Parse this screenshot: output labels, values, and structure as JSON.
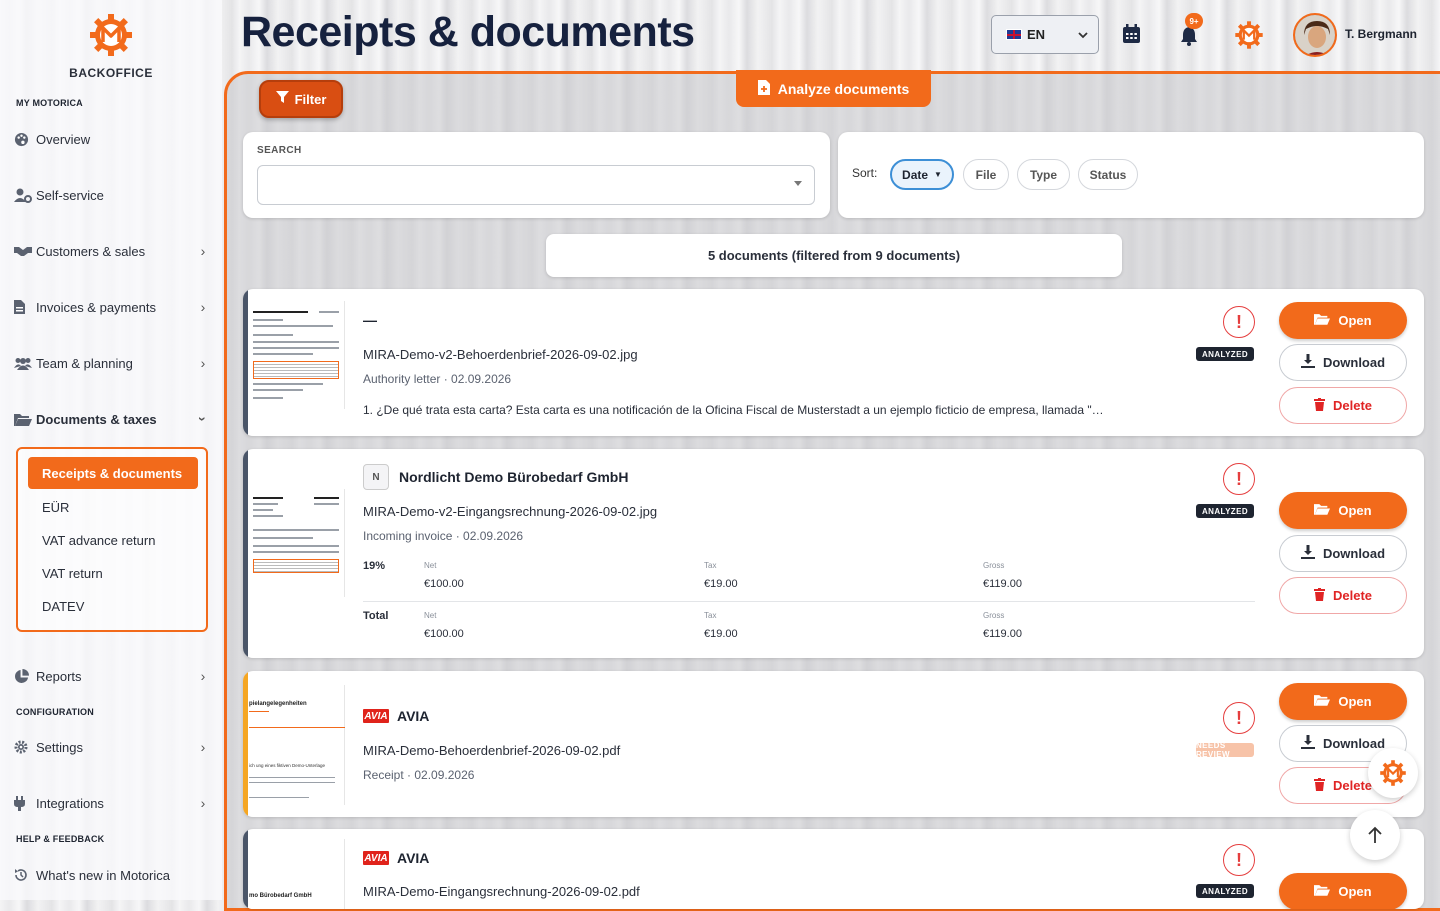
{
  "brand": {
    "name": "BACKOFFICE",
    "accent": "#f26a1b"
  },
  "page_title": "Receipts & documents",
  "header": {
    "language": "EN",
    "notification_badge": "9+",
    "user_name": "T. Bergmann"
  },
  "sidebar": {
    "section_my": "MY MOTORICA",
    "items": [
      {
        "label": "Overview",
        "icon": "palette-icon"
      },
      {
        "label": "Self-service",
        "icon": "user-gear-icon"
      },
      {
        "label": "Customers & sales",
        "icon": "handshake-icon"
      },
      {
        "label": "Invoices & payments",
        "icon": "file-invoice-icon"
      },
      {
        "label": "Team & planning",
        "icon": "users-icon"
      },
      {
        "label": "Documents & taxes",
        "icon": "folder-open-icon"
      }
    ],
    "sub_items": [
      {
        "label": "Receipts & documents"
      },
      {
        "label": "EÜR"
      },
      {
        "label": "VAT advance return"
      },
      {
        "label": "VAT return"
      },
      {
        "label": "DATEV"
      }
    ],
    "reports": "Reports",
    "section_config": "CONFIGURATION",
    "settings": "Settings",
    "integrations": "Integrations",
    "section_help": "HELP & FEEDBACK",
    "whats_new": "What's new in Motorica"
  },
  "toolbar": {
    "filter_label": "Filter",
    "analyze_label": "Analyze documents"
  },
  "search": {
    "label": "SEARCH",
    "placeholder": ""
  },
  "sort": {
    "label": "Sort:",
    "options": [
      {
        "label": "Date"
      },
      {
        "label": "File"
      },
      {
        "label": "Type"
      },
      {
        "label": "Status"
      }
    ],
    "active": "Date"
  },
  "count_text": "5 documents (filtered from 9 documents)",
  "actions": {
    "open": "Open",
    "download": "Download",
    "delete": "Delete"
  },
  "documents": [
    {
      "title": "—",
      "file": "MIRA-Demo-v2-Behoerdenbrief-2026-09-02.jpg",
      "meta": "Authority letter · 02.09.2026",
      "status": "ANALYZED",
      "excerpt": "1. ¿De qué trata esta carta? Esta carta es una notificación de la Oficina Fiscal de Musterstadt a un ejemplo ficticio de empresa, llamada \"…"
    },
    {
      "avatar_letter": "N",
      "title": "Nordlicht Demo Bürobedarf GmbH",
      "file": "MIRA-Demo-v2-Eingangsrechnung-2026-09-02.jpg",
      "meta": "Incoming invoice · 02.09.2026",
      "status": "ANALYZED",
      "tax_rows": [
        {
          "rate": "19%",
          "net_label": "Net",
          "net": "€100.00",
          "tax_label": "Tax",
          "tax": "€19.00",
          "gross_label": "Gross",
          "gross": "€119.00"
        },
        {
          "rate": "Total",
          "net_label": "Net",
          "net": "€100.00",
          "tax_label": "Tax",
          "tax": "€19.00",
          "gross_label": "Gross",
          "gross": "€119.00"
        }
      ]
    },
    {
      "logo_text": "AVIA",
      "title": "AVIA",
      "file": "MIRA-Demo-Behoerdenbrief-2026-09-02.pdf",
      "meta": "Receipt · 02.09.2026",
      "status": "NEEDS REVIEW",
      "thumb_text_1": "pielangelegenheiten",
      "thumb_text_2": "ich ung eines fiktiven Demo-Unterlage"
    },
    {
      "logo_text": "AVIA",
      "title": "AVIA",
      "file": "MIRA-Demo-Eingangsrechnung-2026-09-02.pdf",
      "status": "ANALYZED",
      "thumb_text": "mo Bürobedarf GmbH"
    }
  ]
}
